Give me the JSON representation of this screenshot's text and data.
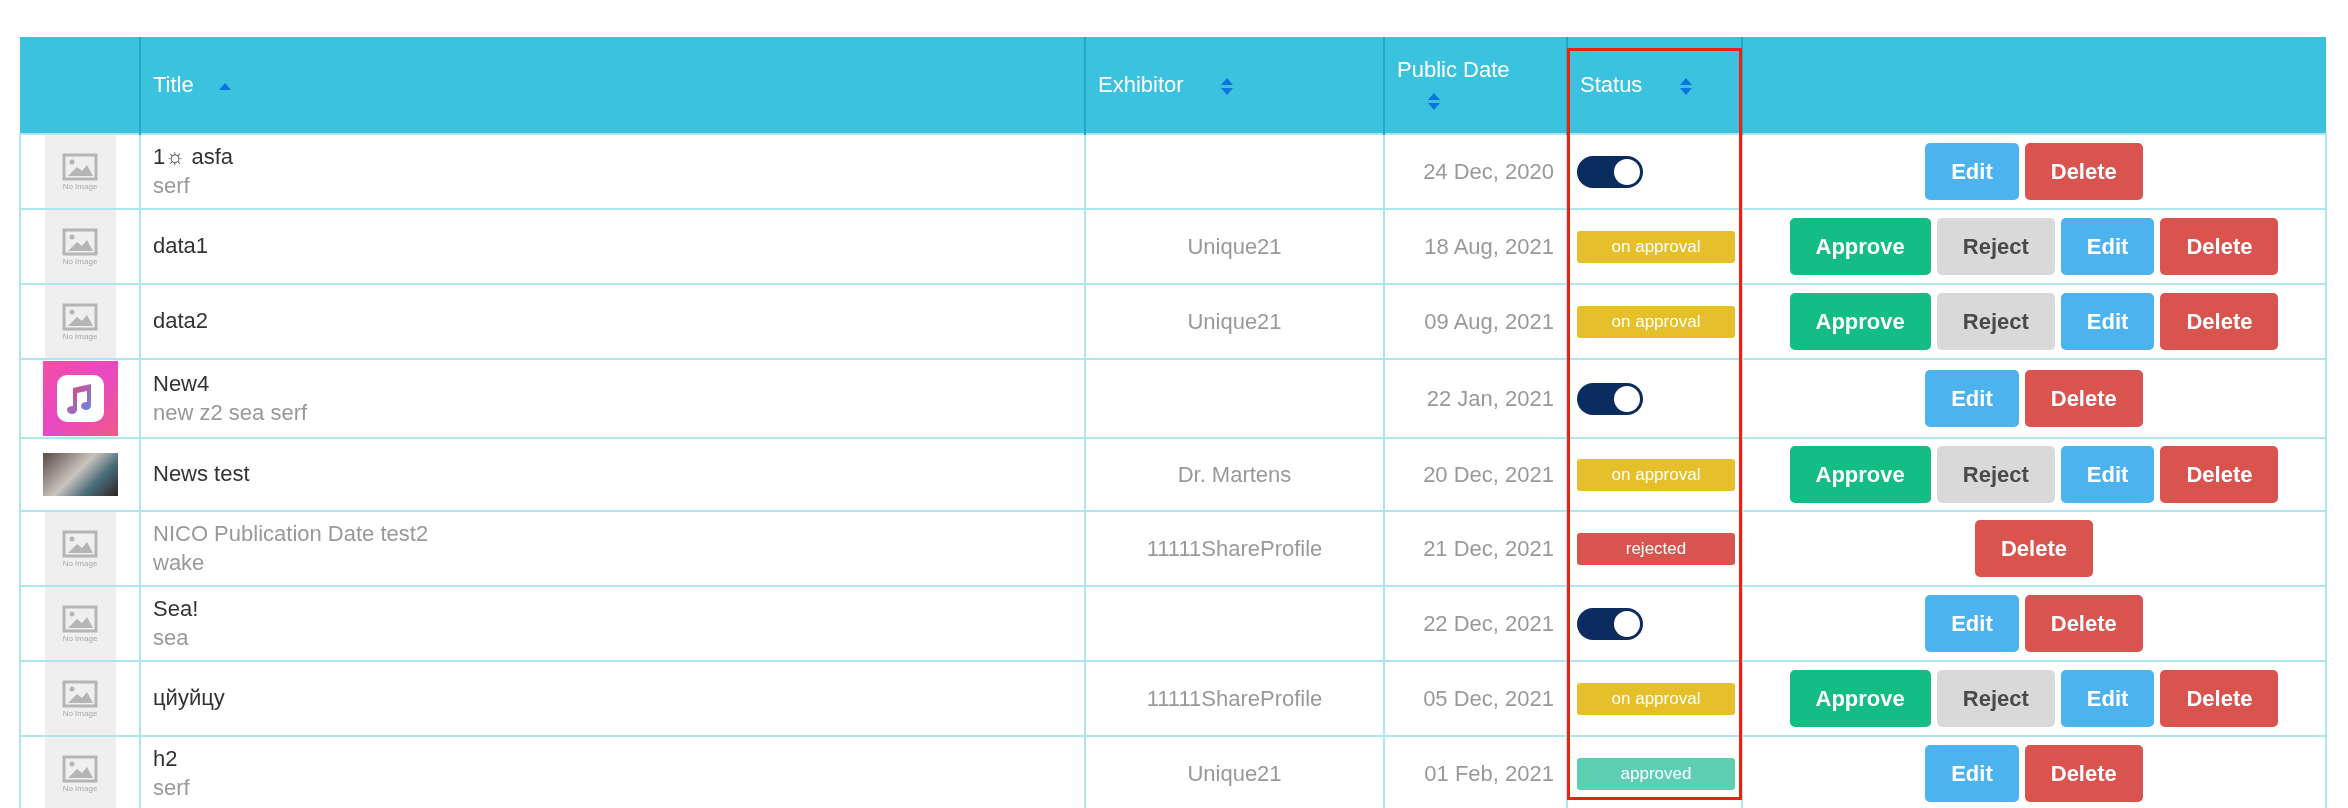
{
  "table": {
    "columns": [
      {
        "highlighted": false
      },
      {
        "label": "Title",
        "sorted": true,
        "highlighted": false
      },
      {
        "label": "Exhibitor",
        "sorted": false,
        "highlighted": false
      },
      {
        "label": "Public Date",
        "sorted": false,
        "highlighted": false
      },
      {
        "label": "Status",
        "sorted": false,
        "highlighted": true
      },
      {
        "highlighted": false
      }
    ],
    "rows": [
      {
        "thumbnail": {
          "kind": "placeholder",
          "label": "No Image"
        },
        "title": "1☼ asfa",
        "subtitle": "serf",
        "dimmed": false,
        "date": "24 Dec, 2020",
        "status": {
          "kind": "toggle",
          "on": true
        },
        "actions": [
          {
            "kind": "edit",
            "label": "Edit"
          },
          {
            "kind": "delete",
            "label": "Delete"
          }
        ]
      },
      {
        "thumbnail": {
          "kind": "placeholder",
          "label": "No Image"
        },
        "title": "data1",
        "dimmed": false,
        "exhibitor": "Unique21",
        "date": "18 Aug, 2021",
        "status": {
          "kind": "badge",
          "label": "on approval",
          "color": "#e5c02a"
        },
        "actions": [
          {
            "kind": "approve",
            "label": "Approve"
          },
          {
            "kind": "reject",
            "label": "Reject"
          },
          {
            "kind": "edit",
            "label": "Edit"
          },
          {
            "kind": "delete",
            "label": "Delete"
          }
        ]
      },
      {
        "thumbnail": {
          "kind": "placeholder",
          "label": "No Image"
        },
        "title": "data2",
        "dimmed": false,
        "exhibitor": "Unique21",
        "date": "09 Aug, 2021",
        "status": {
          "kind": "badge",
          "label": "on approval",
          "color": "#e5c02a"
        },
        "actions": [
          {
            "kind": "approve",
            "label": "Approve"
          },
          {
            "kind": "reject",
            "label": "Reject"
          },
          {
            "kind": "edit",
            "label": "Edit"
          },
          {
            "kind": "delete",
            "label": "Delete"
          }
        ]
      },
      {
        "thumbnail": {
          "kind": "app-icon"
        },
        "title": "New4",
        "subtitle": "new z2 sea serf",
        "dimmed": false,
        "date": "22 Jan, 2021",
        "status": {
          "kind": "toggle",
          "on": true
        },
        "actions": [
          {
            "kind": "edit",
            "label": "Edit"
          },
          {
            "kind": "delete",
            "label": "Delete"
          }
        ]
      },
      {
        "thumbnail": {
          "kind": "photo"
        },
        "title": "News test",
        "dimmed": false,
        "exhibitor": "Dr. Martens",
        "date": "20 Dec, 2021",
        "status": {
          "kind": "badge",
          "label": "on approval",
          "color": "#e5c02a"
        },
        "actions": [
          {
            "kind": "approve",
            "label": "Approve"
          },
          {
            "kind": "reject",
            "label": "Reject"
          },
          {
            "kind": "edit",
            "label": "Edit"
          },
          {
            "kind": "delete",
            "label": "Delete"
          }
        ]
      },
      {
        "thumbnail": {
          "kind": "placeholder",
          "label": "No Image"
        },
        "title": "NICO Publication Date test2",
        "subtitle": "wake",
        "dimmed": true,
        "exhibitor": "11111ShareProfile",
        "date": "21 Dec, 2021",
        "status": {
          "kind": "badge",
          "label": "rejected",
          "color": "#d9534f"
        },
        "actions": [
          {
            "kind": "delete",
            "label": "Delete"
          }
        ]
      },
      {
        "thumbnail": {
          "kind": "placeholder",
          "label": "No Image"
        },
        "title": "Sea!",
        "subtitle": "sea",
        "dimmed": false,
        "date": "22 Dec, 2021",
        "status": {
          "kind": "toggle",
          "on": true
        },
        "actions": [
          {
            "kind": "edit",
            "label": "Edit"
          },
          {
            "kind": "delete",
            "label": "Delete"
          }
        ]
      },
      {
        "thumbnail": {
          "kind": "placeholder",
          "label": "No Image"
        },
        "title": "цйуйцу",
        "dimmed": false,
        "exhibitor": "11111ShareProfile",
        "date": "05 Dec, 2021",
        "status": {
          "kind": "badge",
          "label": "on approval",
          "color": "#e5c02a"
        },
        "actions": [
          {
            "kind": "approve",
            "label": "Approve"
          },
          {
            "kind": "reject",
            "label": "Reject"
          },
          {
            "kind": "edit",
            "label": "Edit"
          },
          {
            "kind": "delete",
            "label": "Delete"
          }
        ]
      },
      {
        "thumbnail": {
          "kind": "placeholder",
          "label": "No Image"
        },
        "title": "h2",
        "subtitle": "serf",
        "dimmed": false,
        "exhibitor": "Unique21",
        "date": "01 Feb, 2021",
        "status": {
          "kind": "badge",
          "label": "approved",
          "color": "#5ecfb1"
        },
        "actions": [
          {
            "kind": "edit",
            "label": "Edit"
          },
          {
            "kind": "delete",
            "label": "Delete"
          }
        ]
      }
    ]
  }
}
